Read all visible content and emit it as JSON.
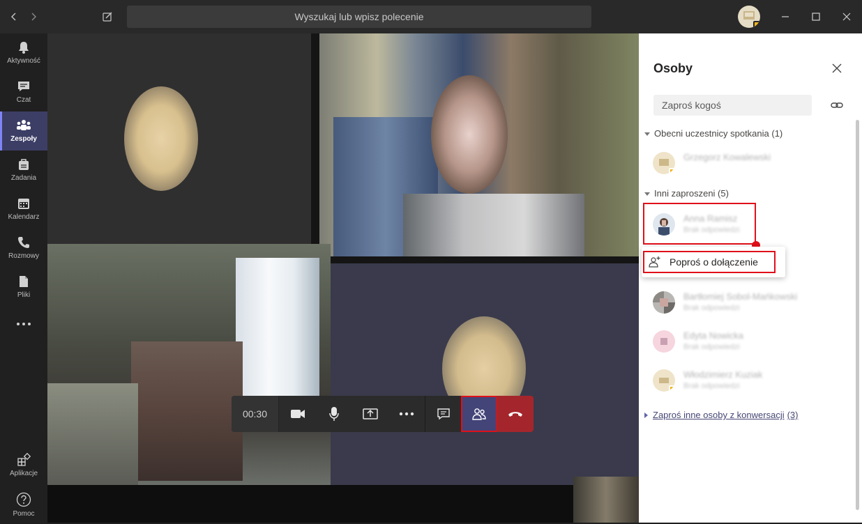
{
  "titlebar": {
    "search_placeholder": "Wyszukaj lub wpisz polecenie",
    "icons": [
      "back-arrow-icon",
      "forward-arrow-icon",
      "compose-icon",
      "minimize-icon",
      "maximize-icon",
      "close-icon"
    ]
  },
  "rail": {
    "items": [
      {
        "label": "Aktywność",
        "icon": "bell-icon"
      },
      {
        "label": "Czat",
        "icon": "chat-icon"
      },
      {
        "label": "Zespoły",
        "icon": "teams-icon",
        "active": true
      },
      {
        "label": "Zadania",
        "icon": "tasks-icon"
      },
      {
        "label": "Kalendarz",
        "icon": "calendar-icon"
      },
      {
        "label": "Rozmowy",
        "icon": "phone-icon"
      },
      {
        "label": "Pliki",
        "icon": "files-icon"
      },
      {
        "label": "",
        "icon": "more-icon"
      }
    ],
    "bottom": [
      {
        "label": "Aplikacje",
        "icon": "apps-icon"
      },
      {
        "label": "Pomoc",
        "icon": "help-icon"
      }
    ]
  },
  "call": {
    "timer": "00:30",
    "buttons": [
      "camera-icon",
      "microphone-icon",
      "share-screen-icon",
      "more-icon",
      "chat-icon",
      "people-icon",
      "hang-up-icon"
    ]
  },
  "panel": {
    "title": "Osoby",
    "invite_placeholder": "Zaproś kogoś",
    "current_header": "Obecni uczestnicy spotkania (1)",
    "current": [
      {
        "name": "Grzegorz Kowalewski",
        "status": ""
      }
    ],
    "others_header": "Inni zaproszeni (5)",
    "others": [
      {
        "name": "Anna Ramisz",
        "status": "Brak odpowiedzi"
      },
      {
        "name": "Bartłomiej Sobol-Mańkowski",
        "status": "Brak odpowiedzi"
      },
      {
        "name": "Edyta Nowicka",
        "status": "Brak odpowiedzi"
      },
      {
        "name": "Włodzimierz Kuziak",
        "status": "Brak odpowiedzi"
      }
    ],
    "context_menu_item": "Poproś o dołączenie",
    "invite_more_link": "Zaproś inne osoby z konwersacji",
    "invite_more_count": "(3)"
  },
  "colors": {
    "accent": "#6264a7",
    "highlight": "#e0101a",
    "hangup": "#a4262c",
    "rail_active": "#3d3e66"
  }
}
